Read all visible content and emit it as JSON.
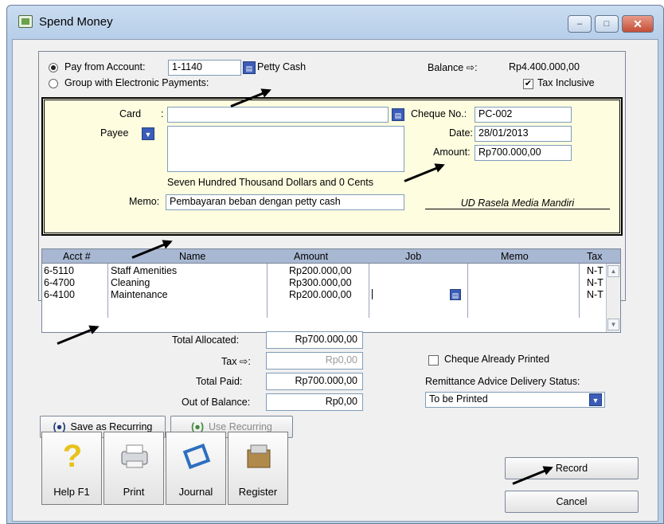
{
  "window": {
    "title": "Spend Money",
    "minimize_label": "–",
    "maximize_label": "□",
    "close_label": "✕"
  },
  "account": {
    "pay_from_label": "Pay from Account:",
    "account_number": "1-1140",
    "account_name": "Petty Cash",
    "group_label": "Group with Electronic Payments:",
    "balance_label": "Balance ⇨:",
    "balance_value": "Rp4.400.000,00",
    "tax_inclusive_label": "Tax Inclusive",
    "tax_inclusive_checked": true
  },
  "card": {
    "card_label": "Card",
    "card_colon": ":",
    "card_value": "",
    "payee_label": "Payee",
    "payee_value": "",
    "amount_words": "Seven Hundred Thousand Dollars and 0 Cents",
    "memo_label": "Memo:",
    "memo_value": "Pembayaran beban dengan petty cash",
    "company_name": "UD Rasela Media Mandiri",
    "cheque_no_label": "Cheque No.:",
    "cheque_no_value": "PC-002",
    "date_label": "Date:",
    "date_value": "28/01/2013",
    "amount_label": "Amount:",
    "amount_value": "Rp700.000,00"
  },
  "table": {
    "columns": [
      "Acct #",
      "Name",
      "Amount",
      "Job",
      "Memo",
      "Tax"
    ],
    "rows": [
      {
        "acct": "6-5110",
        "name": "Staff Amenities",
        "amount": "Rp200.000,00",
        "job": "",
        "memo": "",
        "tax": "N-T"
      },
      {
        "acct": "6-4700",
        "name": "Cleaning",
        "amount": "Rp300.000,00",
        "job": "",
        "memo": "",
        "tax": "N-T"
      },
      {
        "acct": "6-4100",
        "name": "Maintenance",
        "amount": "Rp200.000,00",
        "job": "",
        "memo": "",
        "tax": "N-T"
      }
    ]
  },
  "totals": {
    "allocated_label": "Total Allocated:",
    "allocated_value": "Rp700.000,00",
    "tax_label": "Tax ⇨:",
    "tax_value": "Rp0,00",
    "paid_label": "Total Paid:",
    "paid_value": "Rp700.000,00",
    "oob_label": "Out of Balance:",
    "oob_value": "Rp0,00"
  },
  "options": {
    "cheque_printed_label": "Cheque Already Printed",
    "cheque_printed_checked": false,
    "remittance_label": "Remittance Advice Delivery Status:",
    "remittance_value": "To be Printed"
  },
  "recurring": {
    "save_label": "Save as Recurring",
    "use_label": "Use Recurring"
  },
  "toolbar": {
    "help_label": "Help F1",
    "print_label": "Print",
    "journal_label": "Journal",
    "register_label": "Register",
    "record_label": "Record",
    "cancel_label": "Cancel"
  },
  "colors": {
    "card_background": "#fefde0",
    "table_header": "#a9b8d2",
    "dropdown_button": "#3b5cb8"
  }
}
